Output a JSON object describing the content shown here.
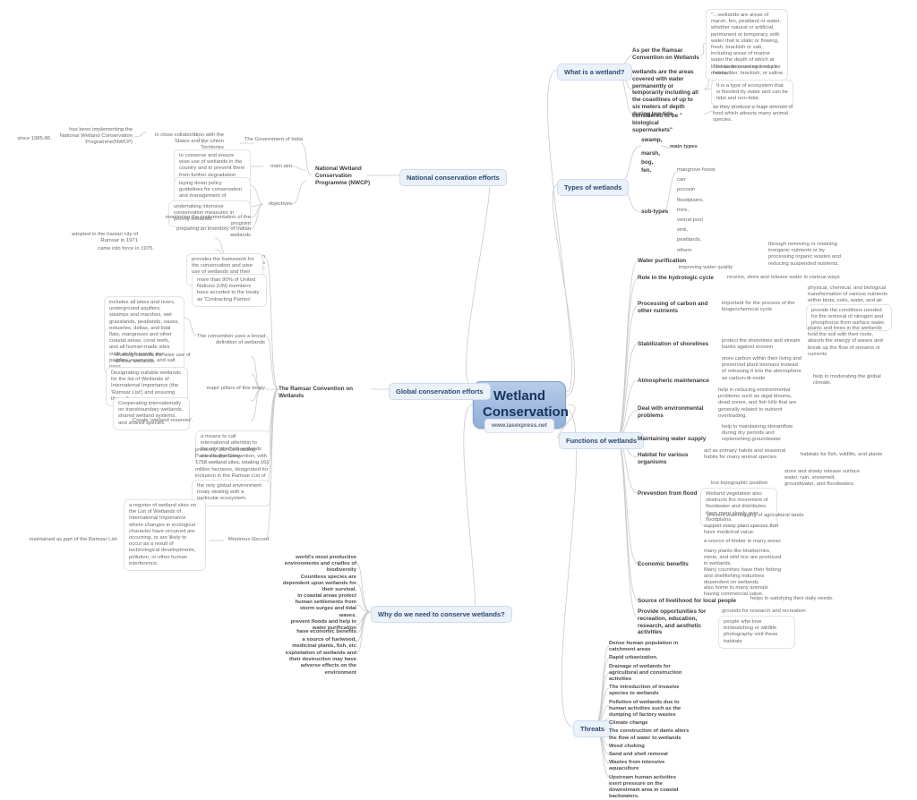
{
  "central": {
    "title": "Wetland\nConservation",
    "badge": "www.iasexpress.net"
  },
  "topics": {
    "what_is": "What is a wetland?",
    "types": "Types of wetlands",
    "functions": "Functions of wetlands",
    "threats": "Threats",
    "why_conserve": "Why do we need to conserve wetlands?",
    "global": "Global conservation efforts",
    "national": "National conservation efforts"
  },
  "what_is_a_wetland": {
    "ramsar_def_label": "As per the Ramsar Convention on Wetlands",
    "ramsar_def_text": "\"…wetlands are areas of marsh, fen, peatland or water, whether natural or artificial, permanent or temporary, with water that is static or flowing, fresh, brackish or salt, including areas of marine water the depth of which at low tide does not exceed six metres.\"",
    "areas_label": "wetlands are the areas covered with water permanently or temporarily including all the coastlines of up to six meters of depth during low tide.",
    "areas_children": [
      "The water covering it may be freshwater, brackish, or saline.",
      "It is a type of ecosystem that is flooded by water and can be tidal and non-tidal."
    ],
    "supermarkets_label": "considered to be \" biological supermarkets\"",
    "supermarkets_child": "as they produce a huge amount of food which attracts many animal species."
  },
  "types_of_wetlands": {
    "main_types_label": "main types",
    "main_types": [
      "swamp,",
      "marsh,",
      "bog,",
      "fen."
    ],
    "sub_types_label": "sub-types",
    "sub_types": [
      "mangrove forest",
      "carr",
      "pocosin",
      "floodplains,",
      "mire,",
      "vernal pool",
      "sink,",
      "peatlands,",
      "others"
    ]
  },
  "functions_of_wetlands": [
    {
      "label": "Water purification",
      "children": [
        {
          "text": "improving water quality",
          "children": [
            "through removing or retaining inorganic nutrients or by processing organic wastes and reducing suspended nutrients."
          ]
        }
      ]
    },
    {
      "label": "Role in the hydrologic cycle",
      "children": [
        {
          "text": "receive, store and release water in various ways",
          "children": []
        }
      ]
    },
    {
      "label": "Processing of carbon and other nutrients",
      "children": [
        {
          "text": "important for the process of the biogeochemical cycle",
          "children": [
            "physical, chemical, and biological transformation of various nutrients within biota, soils, water, and air",
            "provide the conditions needed for the removal of nitrogen and phosphorus from surface water."
          ]
        }
      ]
    },
    {
      "label": "Stabilization of shorelines",
      "children": [
        {
          "text": "protect the shorelines and stream banks against erosion",
          "children": [
            "plants and trees in the wetlands hold the soil with their roots, absorb the energy of waves and break up the flow of streams or currents"
          ]
        }
      ]
    },
    {
      "label": "Atmospheric maintenance",
      "children": [
        {
          "text": "store carbon within their living and preserved plant biomass instead of releasing it into the atmosphere as carbon-di-oxide",
          "children": [
            "help in moderating the global climate."
          ]
        }
      ]
    },
    {
      "label": "Deal with environmental problems",
      "children": [
        {
          "text": "help in reducing environmental problems such as algal blooms, dead zones, and fish kills that are generally related to nutrient overloading.",
          "children": []
        }
      ]
    },
    {
      "label": "Maintaining water supply",
      "children": [
        {
          "text": "help in maintaining streamflow during dry periods and replenishing groundwater",
          "children": []
        }
      ]
    },
    {
      "label": "Habitat for various organisms",
      "children": [
        {
          "text": "act as primary habits and seasonal habits for many animal species.",
          "children": [
            "habitats for fish, wildlife, and plants"
          ]
        }
      ]
    },
    {
      "label": "Prevention from flood",
      "children": [
        {
          "text": "low topographic position",
          "children": [
            "store and slowly release surface water, rain, snowmelt, groundwater, and floodwaters"
          ]
        },
        {
          "text": "Wetland vegetation also obstructs the movement of floodwater and distributes them more slowly over floodplains.",
          "children": []
        },
        {
          "text": "prevent waterlogging of agricultural lands",
          "children": []
        }
      ]
    },
    {
      "label": "Economic benefits",
      "children": [
        {
          "text": "support many plant species that have medicinal value.",
          "children": []
        },
        {
          "text": "a source of timber in many areas",
          "children": []
        },
        {
          "text": "many plants like blueberries, mints, and wild rice are produced in wetlands.",
          "children": []
        },
        {
          "text": "Many countries have their fishing and shellfishing industries dependent on wetlands",
          "children": []
        },
        {
          "text": "also home to many animals having commercial value.",
          "children": []
        }
      ]
    },
    {
      "label": "Source of livelihood for local people",
      "children": [
        {
          "text": "helps in satisfying their daily needs.",
          "children": []
        }
      ]
    },
    {
      "label": "Provide opportunities for recreation, education, research, and aesthetic activities",
      "children": [
        {
          "text": "grounds for research and recreation",
          "children": []
        },
        {
          "text": "people who love birdwatching or wildlife photography visit these habitats",
          "children": []
        }
      ]
    }
  ],
  "threats": [
    "Dense human population in catchment areas",
    "Rapid urbanization.",
    "Drainage of wetlands for agricultural and construction activities",
    "The introduction of invasive species to wetlands",
    "Pollution of wetlands due to human activities such as the dumping of factory wastes",
    "Climate change",
    "The construction of dams alters the flow of water to wetlands",
    "Weed choking",
    "Sand and shell removal",
    "Wastes from intensive aquaculture",
    "Upstream human activities exert pressure on the downstream area in coastal backwaters."
  ],
  "why_conserve": [
    "world's most productive environments and cradles of biodiversity",
    "Countless species are dependent upon wetlands for their survival.",
    "in coastal areas protect human settlements from storm surges and tidal waves.",
    "prevent floods and help in water purification",
    "have economic benefits",
    "a source of fuelwood, medicinal plants, fish, etc",
    "exploitation of wetlands and their destruction may have adverse effects on the environment"
  ],
  "ramsar": {
    "title": "The  Ramsar Convention on Wetlands",
    "treaty_label": "an intergovernmental treaty on wetlands",
    "adopted": "adopted in the Iranian city of Ramsar in 1971",
    "force": "came into force in 1975.",
    "framework": "provides the framework for the conservation and wise use of wetlands and their resources",
    "un_members": "more than 90% of United Nations (UN) members have acceded to the treaty as 'Contracting Parties'.",
    "broad_def_label": "The convention uses a broad definition of wetlands",
    "broad_def_text": "includes all lakes and rivers, underground aquifers, swamps and marshes, wet grasslands, peatlands, oases, estuaries, deltas, and tidal flats, mangroves and other coastal areas, coral reefs, and all human-made sites such as fish ponds, rice paddies, reservoirs, and salt pans.",
    "pillars_label": "major pillars of this treaty",
    "pillars": [
      "Working towards the wise use of all their wetlands",
      "Designating suitable wetlands for the list of Wetlands of International Importance (the 'Ramsar List') and ensuring their effective management.",
      "Cooperating internationally on transboundary wetlands, shared wetland systems, and shared species.",
      "Create 'wetland reserves'."
    ],
    "attention": "a means to call international attention to the rate at which wetlands are disappearing.",
    "parties": "presently 158 Contracting Parties to the Convention, with 1758 wetland sites, totaling 161 million hectares, designated for inclusion in the Ramsar List of Wetlands of International Importance.",
    "only_treaty": "the only global environment treaty dealing with a particular ecosystem.",
    "montreux_label": "Montreux Record",
    "montreux_text": "a register of wetland sites on the List of Wetlands of International Importance where changes in ecological character have occurred are occurring, or are likely to occur as a result of technological developments, pollution, or other human interference.",
    "montreux_child": "maintained as part of the Ramsar List."
  },
  "nwcp": {
    "title": "National Wetland Conservation Programme (NWCP)",
    "govt": "The Government of India",
    "collaboration": "in close collaboration with the States and the Union Territories",
    "implementing": "has been implementing the National Wetland Conservation Programme(NWCP)",
    "since": "since 1985-86.",
    "main_aim_label": "main aim",
    "main_aim_text": "to conserve and ensure wise use of wetlands in the country and to prevent them from further degradation",
    "objectives_label": "objectives",
    "objectives": [
      "laying down policy guidelines for conservation and management of wetlands in the country",
      "undertaking intensive conservation measures in priority wetlands",
      "monitoring the implementation of the program",
      "preparing an inventory of Indian wetlands"
    ]
  }
}
